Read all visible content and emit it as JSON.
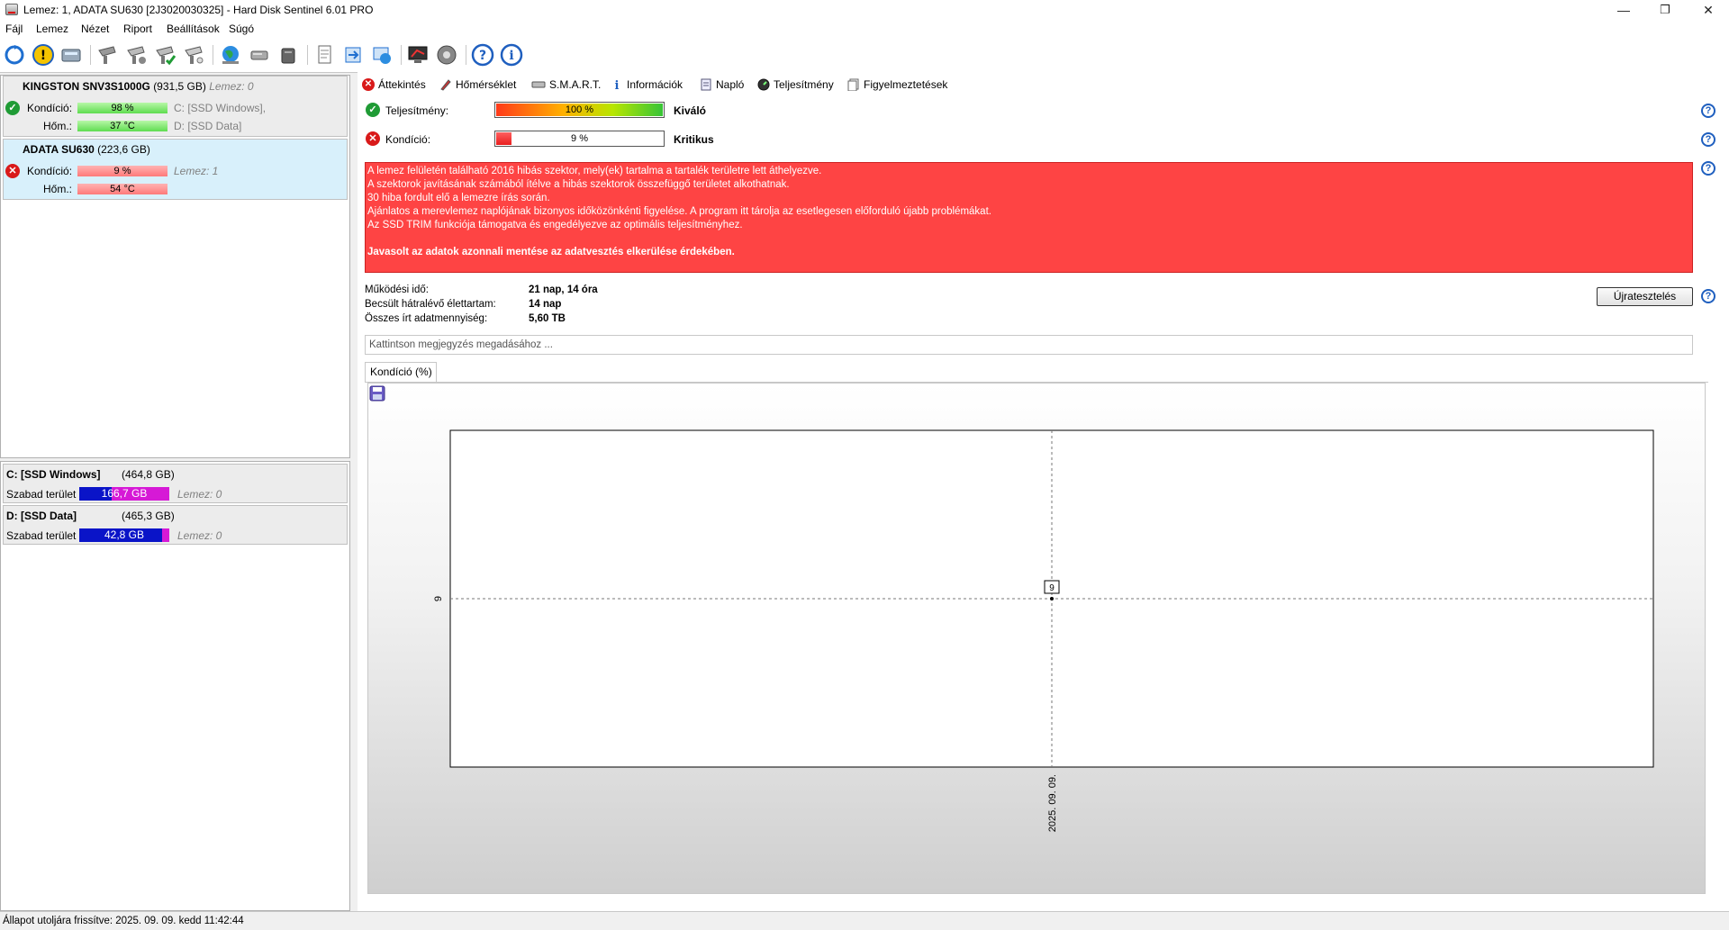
{
  "window": {
    "title": "Lemez: 1, ADATA SU630 [2J3020030325]  -  Hard Disk Sentinel 6.01 PRO",
    "minimize": "—",
    "maximize": "❐",
    "close": "✕"
  },
  "menu": [
    "Fájl",
    "Lemez",
    "Nézet",
    "Riport",
    "Beállítások",
    "Súgó"
  ],
  "disks": [
    {
      "name": "KINGSTON SNV3S1000G",
      "size": "(931,5 GB)",
      "disk_label": "Lemez: 0",
      "health_label": "Kondíció:",
      "health_value": "98 %",
      "health_percent": 98,
      "temp_label": "Hőm.:",
      "temp_value": "37 °C",
      "volume1": "C: [SSD Windows],",
      "volume2": "D: [SSD Data]",
      "status": "ok"
    },
    {
      "name": "ADATA SU630",
      "size": "(223,6 GB)",
      "disk_label": "Lemez: 1",
      "health_label": "Kondíció:",
      "health_value": "9 %",
      "health_percent": 9,
      "temp_label": "Hőm.:",
      "temp_value": "54 °C",
      "status": "bad"
    }
  ],
  "volumes": [
    {
      "name": "C: [SSD Windows]",
      "size": "(464,8 GB)",
      "free_label": "Szabad terület",
      "free_value": "166,7 GB",
      "free_fraction": 0.36,
      "disk": "Lemez: 0"
    },
    {
      "name": "D: [SSD Data]",
      "size": "(465,3 GB)",
      "free_label": "Szabad terület",
      "free_value": "42,8 GB",
      "free_fraction": 0.92,
      "disk": "Lemez: 0"
    }
  ],
  "tabs": [
    "Áttekintés",
    "Hőmérséklet",
    "S.M.A.R.T.",
    "Információk",
    "Napló",
    "Teljesítmény",
    "Figyelmeztetések"
  ],
  "overview": {
    "performance_label": "Teljesítmény:",
    "performance_value": "100 %",
    "performance_percent": 100,
    "performance_status": "Kiváló",
    "health_label": "Kondíció:",
    "health_value": "9 %",
    "health_percent": 9,
    "health_status": "Kritikus",
    "alert_lines": [
      "A lemez felületén található 2016 hibás szektor, mely(ek) tartalma a tartalék területre lett áthelyezve.",
      "A szektorok javításának számából ítélve a hibás szektorok összefüggő területet alkothatnak.",
      "30 hiba fordult elő a lemezre írás során.",
      "Ajánlatos a merevlemez naplójának bizonyos időközönkénti figyelése. A program itt tárolja az esetlegesen előforduló újabb problémákat.",
      "Az SSD TRIM funkciója támogatva és engedélyezve az optimális teljesítményhez."
    ],
    "alert_bold": "Javasolt az adatok azonnali mentése az adatvesztés elkerülése érdekében.",
    "uptime_label": "Működési idő:",
    "uptime_value": "21 nap, 14 óra",
    "lifetime_label": "Becsült hátralévő élettartam:",
    "lifetime_value": "14 nap",
    "written_label": "Összes írt adatmennyiség:",
    "written_value": "5,60 TB",
    "retest_button": "Újratesztelés",
    "note_placeholder": "Kattintson megjegyzés megadásához ...",
    "chart_tab": "Kondíció  (%)"
  },
  "chart_data": {
    "type": "line",
    "x": [
      "2025. 09. 09."
    ],
    "values": [
      9
    ],
    "y_tick_labels": [
      "9"
    ],
    "data_labels": [
      "9"
    ],
    "grid": true
  },
  "status_bar": "Állapot utoljára frissítve: 2025. 09. 09. kedd 11:42:44",
  "colors": {
    "alert_bg": "#fe4444",
    "ok": "#1f9b35",
    "bad": "#d91a1a",
    "selected_disk": "#d8f0fb",
    "free_space": "#0a14c8",
    "used_space": "#d619d6"
  }
}
